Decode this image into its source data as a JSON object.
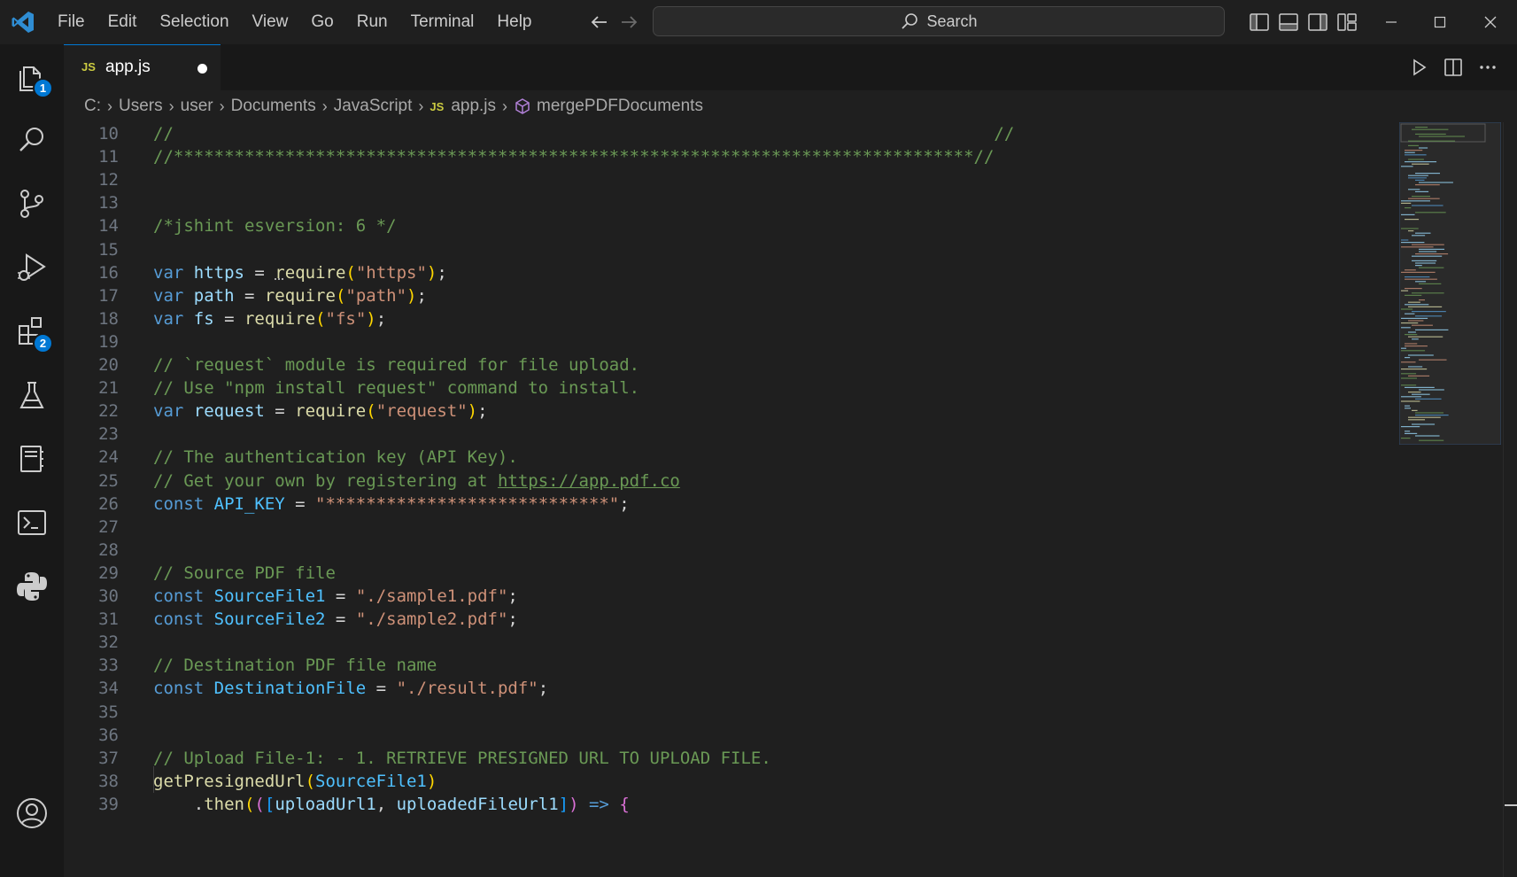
{
  "menu": [
    "File",
    "Edit",
    "Selection",
    "View",
    "Go",
    "Run",
    "Terminal",
    "Help"
  ],
  "search": {
    "label": "Search"
  },
  "activity_badges": {
    "explorer": "1",
    "extensions": "2"
  },
  "tab": {
    "lang_badge": "JS",
    "filename": "app.js"
  },
  "breadcrumb": {
    "items": [
      "C:",
      "Users",
      "user",
      "Documents",
      "JavaScript"
    ],
    "file_badge": "JS",
    "file": "app.js",
    "symbol": "mergePDFDocuments"
  },
  "code_lines": [
    {
      "n": 10,
      "tokens": [
        [
          "com",
          "//                                                                                 //"
        ]
      ]
    },
    {
      "n": 11,
      "tokens": [
        [
          "com",
          "//*******************************************************************************//"
        ]
      ]
    },
    {
      "n": 12,
      "tokens": []
    },
    {
      "n": 13,
      "tokens": []
    },
    {
      "n": 14,
      "tokens": [
        [
          "com",
          "/*jshint esversion: 6 */"
        ]
      ]
    },
    {
      "n": 15,
      "tokens": []
    },
    {
      "n": 16,
      "tokens": [
        [
          "kw",
          "var "
        ],
        [
          "var",
          "https"
        ],
        [
          "op",
          " = "
        ],
        [
          "fn-dotted",
          "r"
        ],
        [
          "fn",
          "equire"
        ],
        [
          "p1",
          "("
        ],
        [
          "str",
          "\"https\""
        ],
        [
          "p1",
          ")"
        ],
        [
          "op",
          ";"
        ]
      ]
    },
    {
      "n": 17,
      "tokens": [
        [
          "kw",
          "var "
        ],
        [
          "var",
          "path"
        ],
        [
          "op",
          " = "
        ],
        [
          "fn",
          "require"
        ],
        [
          "p1",
          "("
        ],
        [
          "str",
          "\"path\""
        ],
        [
          "p1",
          ")"
        ],
        [
          "op",
          ";"
        ]
      ]
    },
    {
      "n": 18,
      "tokens": [
        [
          "kw",
          "var "
        ],
        [
          "var",
          "fs"
        ],
        [
          "op",
          " = "
        ],
        [
          "fn",
          "require"
        ],
        [
          "p1",
          "("
        ],
        [
          "str",
          "\"fs\""
        ],
        [
          "p1",
          ")"
        ],
        [
          "op",
          ";"
        ]
      ]
    },
    {
      "n": 19,
      "tokens": []
    },
    {
      "n": 20,
      "tokens": [
        [
          "com",
          "// `request` module is required for file upload."
        ]
      ]
    },
    {
      "n": 21,
      "tokens": [
        [
          "com",
          "// Use \"npm install request\" command to install."
        ]
      ]
    },
    {
      "n": 22,
      "tokens": [
        [
          "kw",
          "var "
        ],
        [
          "var",
          "request"
        ],
        [
          "op",
          " = "
        ],
        [
          "fn",
          "require"
        ],
        [
          "p1",
          "("
        ],
        [
          "str",
          "\"request\""
        ],
        [
          "p1",
          ")"
        ],
        [
          "op",
          ";"
        ]
      ]
    },
    {
      "n": 23,
      "tokens": []
    },
    {
      "n": 24,
      "tokens": [
        [
          "com",
          "// The authentication key (API Key)."
        ]
      ]
    },
    {
      "n": 25,
      "tokens": [
        [
          "com",
          "// Get your own by registering at "
        ],
        [
          "link",
          "https://app.pdf.co"
        ]
      ]
    },
    {
      "n": 26,
      "tokens": [
        [
          "kw",
          "const "
        ],
        [
          "const",
          "API_KEY"
        ],
        [
          "op",
          " = "
        ],
        [
          "str",
          "\"****************************\""
        ],
        [
          "op",
          ";"
        ]
      ]
    },
    {
      "n": 27,
      "tokens": []
    },
    {
      "n": 28,
      "tokens": []
    },
    {
      "n": 29,
      "tokens": [
        [
          "com",
          "// Source PDF file"
        ]
      ]
    },
    {
      "n": 30,
      "tokens": [
        [
          "kw",
          "const "
        ],
        [
          "const",
          "SourceFile1"
        ],
        [
          "op",
          " = "
        ],
        [
          "str",
          "\"./sample1.pdf\""
        ],
        [
          "op",
          ";"
        ]
      ]
    },
    {
      "n": 31,
      "tokens": [
        [
          "kw",
          "const "
        ],
        [
          "const",
          "SourceFile2"
        ],
        [
          "op",
          " = "
        ],
        [
          "str",
          "\"./sample2.pdf\""
        ],
        [
          "op",
          ";"
        ]
      ]
    },
    {
      "n": 32,
      "tokens": []
    },
    {
      "n": 33,
      "tokens": [
        [
          "com",
          "// Destination PDF file name"
        ]
      ]
    },
    {
      "n": 34,
      "tokens": [
        [
          "kw",
          "const "
        ],
        [
          "const",
          "DestinationFile"
        ],
        [
          "op",
          " = "
        ],
        [
          "str",
          "\"./result.pdf\""
        ],
        [
          "op",
          ";"
        ]
      ]
    },
    {
      "n": 35,
      "tokens": []
    },
    {
      "n": 36,
      "tokens": []
    },
    {
      "n": 37,
      "tokens": [
        [
          "com",
          "// Upload File-1: - 1. RETRIEVE PRESIGNED URL TO UPLOAD FILE."
        ]
      ]
    },
    {
      "n": 38,
      "tokens": [
        [
          "fn",
          "getPresignedUrl"
        ],
        [
          "p1",
          "("
        ],
        [
          "const",
          "SourceFile1"
        ],
        [
          "p1",
          ")"
        ]
      ]
    },
    {
      "n": 39,
      "tokens": [
        [
          "op",
          "    ."
        ],
        [
          "fn",
          "then"
        ],
        [
          "p1",
          "("
        ],
        [
          "p2",
          "("
        ],
        [
          "p3",
          "["
        ],
        [
          "var",
          "uploadUrl1"
        ],
        [
          "op",
          ", "
        ],
        [
          "var",
          "uploadedFileUrl1"
        ],
        [
          "p3",
          "]"
        ],
        [
          "p2",
          ")"
        ],
        [
          "kw",
          " => "
        ],
        [
          "p2",
          "{"
        ]
      ]
    }
  ]
}
